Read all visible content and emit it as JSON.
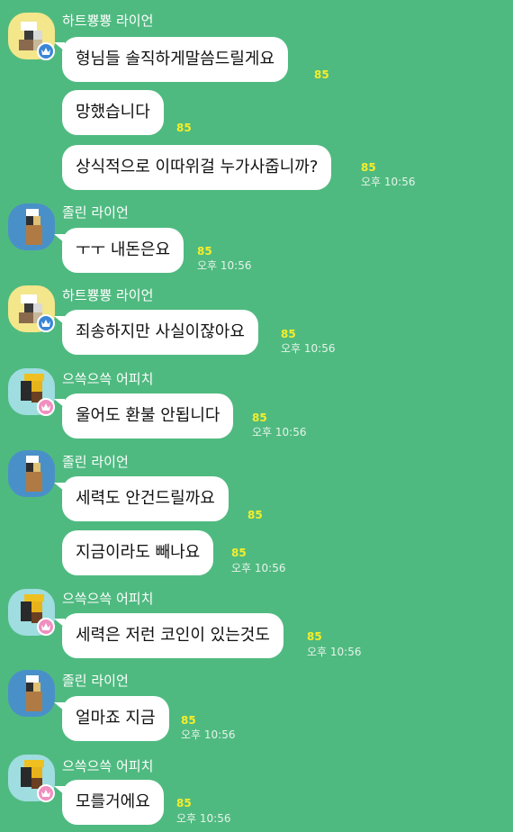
{
  "colors": {
    "background": "#4fba80",
    "bubble": "#ffffff",
    "unread_count": "#f5ee2a",
    "name_text": "#ffffff"
  },
  "messages": [
    {
      "sender": "하트뿅뿅 라이언",
      "avatar": "pixelated-lion-avatar",
      "badge": "crown-icon",
      "lines": [
        {
          "text": "형님들 솔직하게말씀드릴게요",
          "count": "85",
          "time": ""
        },
        {
          "text": "망했습니다",
          "count": "85",
          "time": ""
        },
        {
          "text": "상식적으로 이따위걸 누가사줍니까?",
          "count": "85",
          "time": "오후 10:56"
        }
      ]
    },
    {
      "sender": "졸린 라이언",
      "avatar": "pixelated-lion-avatar",
      "lines": [
        {
          "text": "ㅜㅜ 내돈은요",
          "count": "85",
          "time": "오후 10:56"
        }
      ]
    },
    {
      "sender": "하트뿅뿅 라이언",
      "avatar": "pixelated-lion-avatar",
      "badge": "crown-icon",
      "lines": [
        {
          "text": "죄송하지만 사실이잖아요",
          "count": "85",
          "time": "오후 10:56"
        }
      ]
    },
    {
      "sender": "으쓱으쓱 어피치",
      "avatar": "pixelated-apeach-avatar",
      "badge": "crown-icon",
      "lines": [
        {
          "text": "울어도 환불 안됩니다",
          "count": "85",
          "time": "오후 10:56"
        }
      ]
    },
    {
      "sender": "졸린 라이언",
      "avatar": "pixelated-lion-avatar",
      "lines": [
        {
          "text": "세력도 안건드릴까요",
          "count": "85",
          "time": ""
        },
        {
          "text": "지금이라도 빼나요",
          "count": "85",
          "time": "오후 10:56"
        }
      ]
    },
    {
      "sender": "으쓱으쓱 어피치",
      "avatar": "pixelated-apeach-avatar",
      "badge": "crown-icon",
      "lines": [
        {
          "text": "세력은 저런 코인이 있는것도",
          "count": "85",
          "time": "오후 10:56"
        }
      ]
    },
    {
      "sender": "졸린 라이언",
      "avatar": "pixelated-lion-avatar",
      "lines": [
        {
          "text": "얼마죠 지금",
          "count": "85",
          "time": "오후 10:56"
        }
      ]
    },
    {
      "sender": "으쓱으쓱 어피치",
      "avatar": "pixelated-apeach-avatar",
      "badge": "crown-icon",
      "lines": [
        {
          "text": "모를거에요",
          "count": "85",
          "time": "오후 10:56"
        }
      ]
    }
  ]
}
